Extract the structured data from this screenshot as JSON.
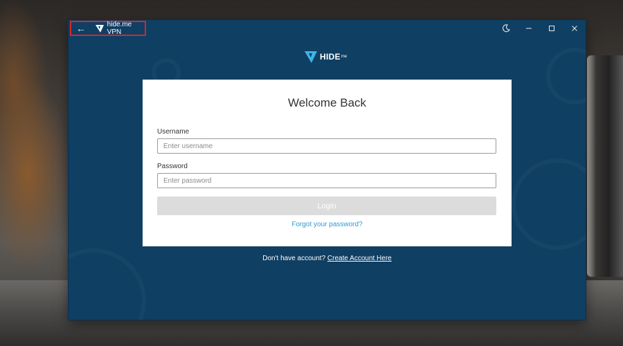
{
  "window": {
    "title": "hide.me VPN",
    "back_icon": "arrow-left-icon",
    "controls": {
      "theme_icon": "moon-icon",
      "minimize_icon": "minimize-icon",
      "maximize_icon": "maximize-icon",
      "close_icon": "close-icon"
    }
  },
  "brand": {
    "logo_text": "HIDE",
    "logo_sub": "me"
  },
  "login": {
    "heading": "Welcome Back",
    "username_label": "Username",
    "username_placeholder": "Enter username",
    "password_label": "Password",
    "password_placeholder": "Enter password",
    "login_button": "Login",
    "forgot_link": "Forgot your password?"
  },
  "signup": {
    "prompt": "Don't have account?",
    "link": "Create Account Here"
  },
  "colors": {
    "window_bg": "#0f3f63",
    "accent": "#2d9bd6",
    "highlight_border": "#d8262b",
    "disabled_button": "#dcdcdc"
  }
}
